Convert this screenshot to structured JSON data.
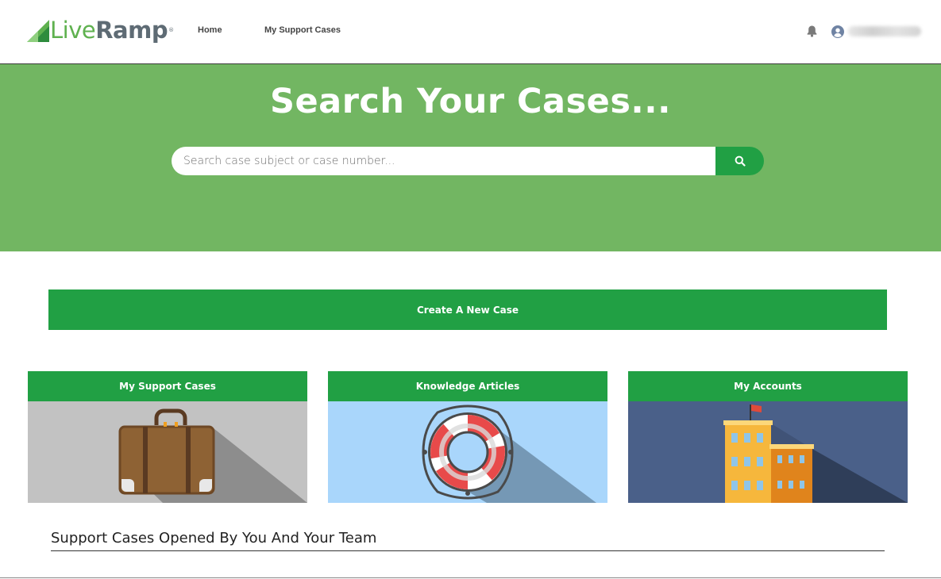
{
  "header": {
    "logo_live": "Live",
    "logo_ramp": "Ramp",
    "logo_tm": "®",
    "nav": {
      "home": "Home",
      "my_support_cases": "My Support Cases"
    },
    "bell_icon": "bell-icon",
    "user_icon": "user-avatar-icon"
  },
  "hero": {
    "title": "Search Your Cases...",
    "search_placeholder": "Search case subject or case number...",
    "search_icon": "search-icon"
  },
  "create_case": {
    "label": "Create A New Case"
  },
  "cards": [
    {
      "title": "My Support Cases",
      "icon": "suitcase-icon"
    },
    {
      "title": "Knowledge Articles",
      "icon": "lifebuoy-icon"
    },
    {
      "title": "My Accounts",
      "icon": "building-icon"
    }
  ],
  "section": {
    "title": "Support Cases Opened By You And Your Team"
  },
  "colors": {
    "brand_green": "#21a044",
    "hero_green": "#72b662",
    "card_grey": "#c2c2c2",
    "card_blue": "#a9d6fb",
    "card_navy": "#4a6089"
  }
}
